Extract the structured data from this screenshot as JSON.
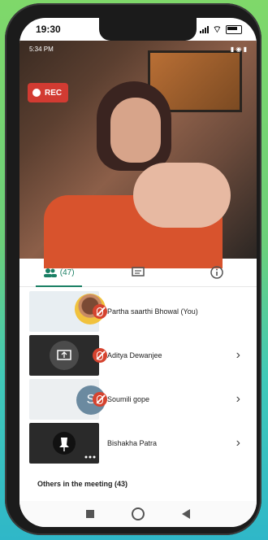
{
  "status_bar": {
    "time": "19:30"
  },
  "video_status": {
    "time": "5:34 PM"
  },
  "recording": {
    "label": "REC"
  },
  "tabs": {
    "people": {
      "label": "(47)"
    }
  },
  "participants": [
    {
      "name": "Partha saarthi Bhowal (You)",
      "muted": true,
      "avatar": "photo"
    },
    {
      "name": "Aditya Dewanjee",
      "muted": true,
      "avatar": "screen-share"
    },
    {
      "name": "Soumili gope",
      "muted": true,
      "avatar": "letter",
      "letter": "S"
    },
    {
      "name": "Bishakha Patra",
      "muted": false,
      "avatar": "pin"
    }
  ],
  "others": {
    "label": "Others in the meeting (43)"
  },
  "colors": {
    "accent": "#1a7f64",
    "danger": "#d5432f"
  }
}
